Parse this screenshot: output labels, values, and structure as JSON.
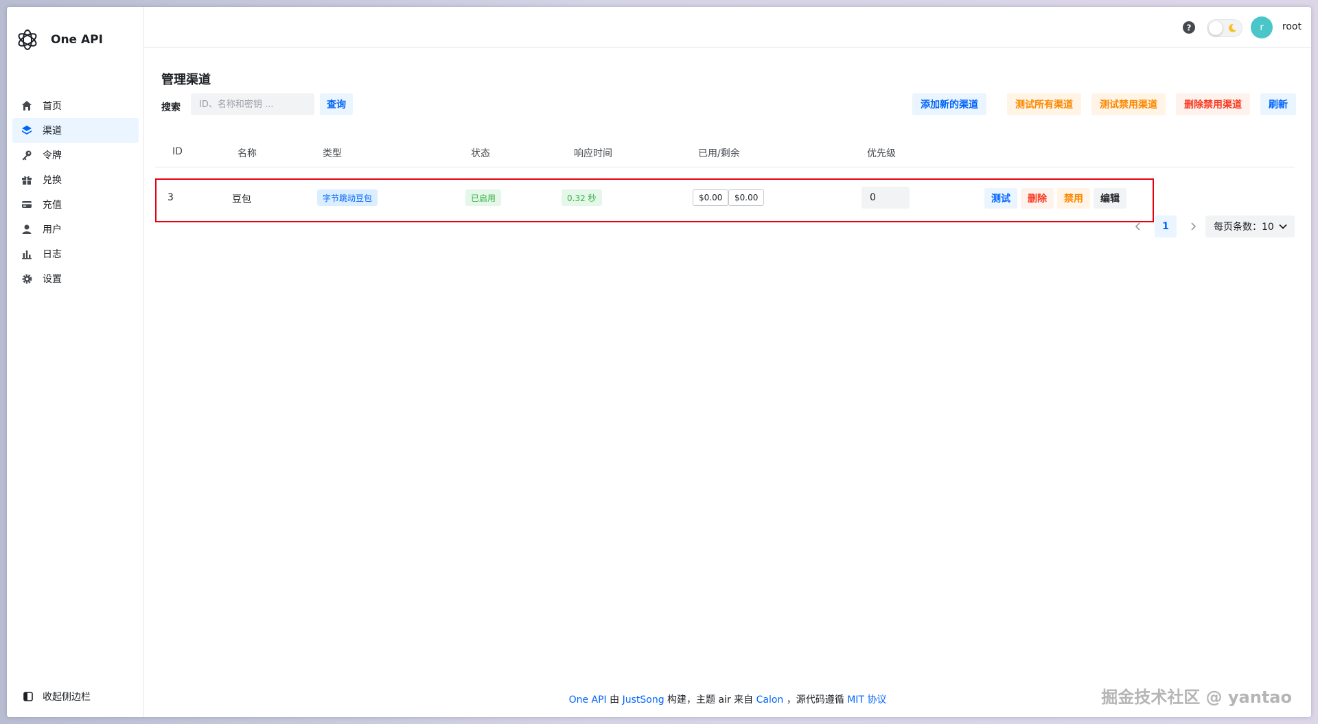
{
  "app": {
    "title": "One API"
  },
  "sidebar": {
    "items": [
      {
        "label": "首页",
        "icon": "home-icon"
      },
      {
        "label": "渠道",
        "icon": "layers-icon",
        "active": true
      },
      {
        "label": "令牌",
        "icon": "key-icon"
      },
      {
        "label": "兑换",
        "icon": "gift-icon"
      },
      {
        "label": "充值",
        "icon": "credit-card-icon"
      },
      {
        "label": "用户",
        "icon": "user-icon"
      },
      {
        "label": "日志",
        "icon": "bar-chart-icon"
      },
      {
        "label": "设置",
        "icon": "gear-icon"
      }
    ],
    "collapse_label": "收起侧边栏"
  },
  "header": {
    "avatar_letter": "r",
    "username": "root",
    "avatar_color": "#4ac6c9"
  },
  "main": {
    "title": "管理渠道",
    "search": {
      "label": "搜索",
      "placeholder": "ID、名称和密钥 ...",
      "value": "",
      "button": "查询"
    },
    "toolbar": {
      "add": "添加新的渠道",
      "test_all": "测试所有渠道",
      "test_disabled": "测试禁用渠道",
      "delete_disabled": "删除禁用渠道",
      "refresh": "刷新"
    },
    "table": {
      "columns": [
        "ID",
        "名称",
        "类型",
        "状态",
        "响应时间",
        "已用/剩余",
        "优先级"
      ],
      "rows": [
        {
          "id": "3",
          "name": "豆包",
          "type": "字节跳动豆包",
          "status": "已启用",
          "response_time": "0.32 秒",
          "used": "$0.00",
          "remaining": "$0.00",
          "priority": "0",
          "actions": {
            "test": "测试",
            "delete": "删除",
            "disable": "禁用",
            "edit": "编辑"
          }
        }
      ]
    },
    "pagination": {
      "current_page": "1",
      "page_size_label": "每页条数：10"
    }
  },
  "footer": {
    "part1": "One API",
    "part2": " 由 ",
    "part3": "JustSong",
    "part4": " 构建，主题 air 来自 ",
    "part5": "Calon",
    "part6": " ，源代码遵循 ",
    "part7": "MIT 协议"
  },
  "watermark": "掘金技术社区 @ yantao",
  "colors": {
    "primary": "#0064fa",
    "warning": "#fc8800",
    "danger": "#f93920",
    "success": "#3bb346",
    "highlight_border": "#e5000f"
  }
}
